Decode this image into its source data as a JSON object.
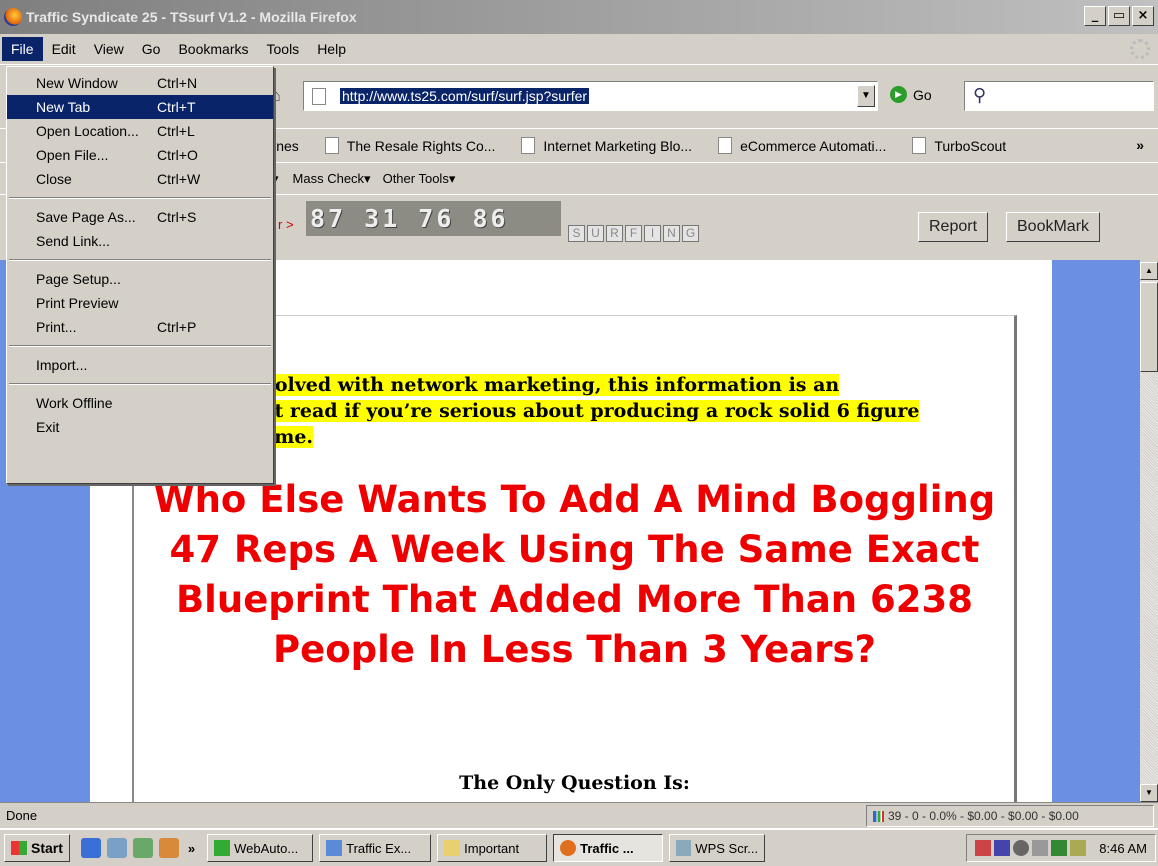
{
  "window": {
    "title": "Traffic Syndicate 25 - TSsurf V1.2 - Mozilla Firefox",
    "buttons": [
      "_",
      "▭",
      "×"
    ]
  },
  "menubar": {
    "items": [
      "File",
      "Edit",
      "View",
      "Go",
      "Bookmarks",
      "Tools",
      "Help"
    ]
  },
  "navbar": {
    "url": "http://www.ts25.com/surf/surf.jsp?surfer",
    "go_label": "Go"
  },
  "bookmarks": {
    "items": [
      "lines",
      "The Resale Rights Co...",
      "Internet Marketing Blo...",
      "eCommerce Automati...",
      "TurboScout"
    ],
    "more": "»"
  },
  "tools": {
    "items": [
      "Mass Check▾",
      "Other Tools▾"
    ],
    "left_fragment": "▾"
  },
  "surfbar": {
    "label": "r >",
    "captcha": "87 31 76 86",
    "surfing_letters": [
      "S",
      "U",
      "R",
      "F",
      "I",
      "N",
      "G"
    ],
    "report": "Report",
    "bookmark": "BookMark"
  },
  "content": {
    "intro": "nvolved with network marketing, this information is an ust read if you're serious about producing a rock solid 6 figure come.",
    "intro_lines": [
      "nvolved with network marketing, this information is an",
      "ust read if you’re serious about producing a rock solid 6 figure",
      "come."
    ],
    "headline": "Who Else Wants To Add A Mind Boggling 47 Reps A Week Using The Same Exact Blueprint That Added More Than 6238 People In Less Than 3 Years?",
    "question": "The Only Question Is:"
  },
  "status": {
    "text": "Done",
    "right": "39 - 0 - 0.0% - $0.00 - $0.00 - $0.00"
  },
  "taskbar": {
    "start": "Start",
    "more": "»",
    "tasks": [
      "WebAuto...",
      "Traffic Ex...",
      "Important",
      "Traffic ...",
      "WPS Scr..."
    ],
    "clock": "8:46 AM"
  },
  "file_menu": {
    "items": [
      {
        "label": "New Window",
        "shortcut": "Ctrl+N"
      },
      {
        "label": "New Tab",
        "shortcut": "Ctrl+T"
      },
      {
        "label": "Open Location...",
        "shortcut": "Ctrl+L"
      },
      {
        "label": "Open File...",
        "shortcut": "Ctrl+O"
      },
      {
        "label": "Close",
        "shortcut": "Ctrl+W"
      },
      {
        "label": "Save Page As...",
        "shortcut": "Ctrl+S"
      },
      {
        "label": "Send Link...",
        "shortcut": ""
      },
      {
        "label": "Page Setup...",
        "shortcut": ""
      },
      {
        "label": "Print Preview",
        "shortcut": ""
      },
      {
        "label": "Print...",
        "shortcut": "Ctrl+P"
      },
      {
        "label": "Import...",
        "shortcut": ""
      },
      {
        "label": "Work Offline",
        "shortcut": ""
      },
      {
        "label": "Exit",
        "shortcut": ""
      }
    ]
  },
  "colors": {
    "accent": "#0a246a",
    "content_bg": "#6a8fe3",
    "headline": "#e00000",
    "highlight": "#ffff00"
  }
}
